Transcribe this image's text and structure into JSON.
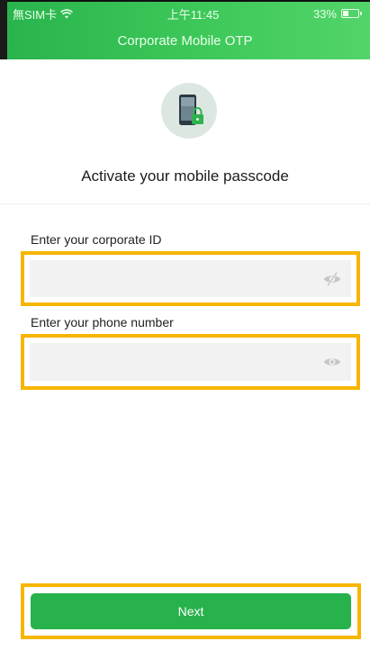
{
  "status_bar": {
    "carrier": "無SIM卡",
    "wifi_icon": "wifi-icon",
    "time": "上午11:45",
    "battery": "33%",
    "battery_level": 0.33
  },
  "header": {
    "title": "Corporate Mobile OTP"
  },
  "hero": {
    "icon": "phone-lock-icon",
    "heading": "Activate your mobile passcode"
  },
  "form": {
    "corporate_id": {
      "label": "Enter your corporate ID",
      "value": "",
      "toggle_icon": "eye-off-icon"
    },
    "phone_number": {
      "label": "Enter your phone number",
      "value": "",
      "toggle_icon": "eye-icon"
    }
  },
  "actions": {
    "next_label": "Next"
  },
  "colors": {
    "brand_green": "#27b24b",
    "highlight": "#f7b500",
    "field_bg": "#f2f2f2"
  }
}
